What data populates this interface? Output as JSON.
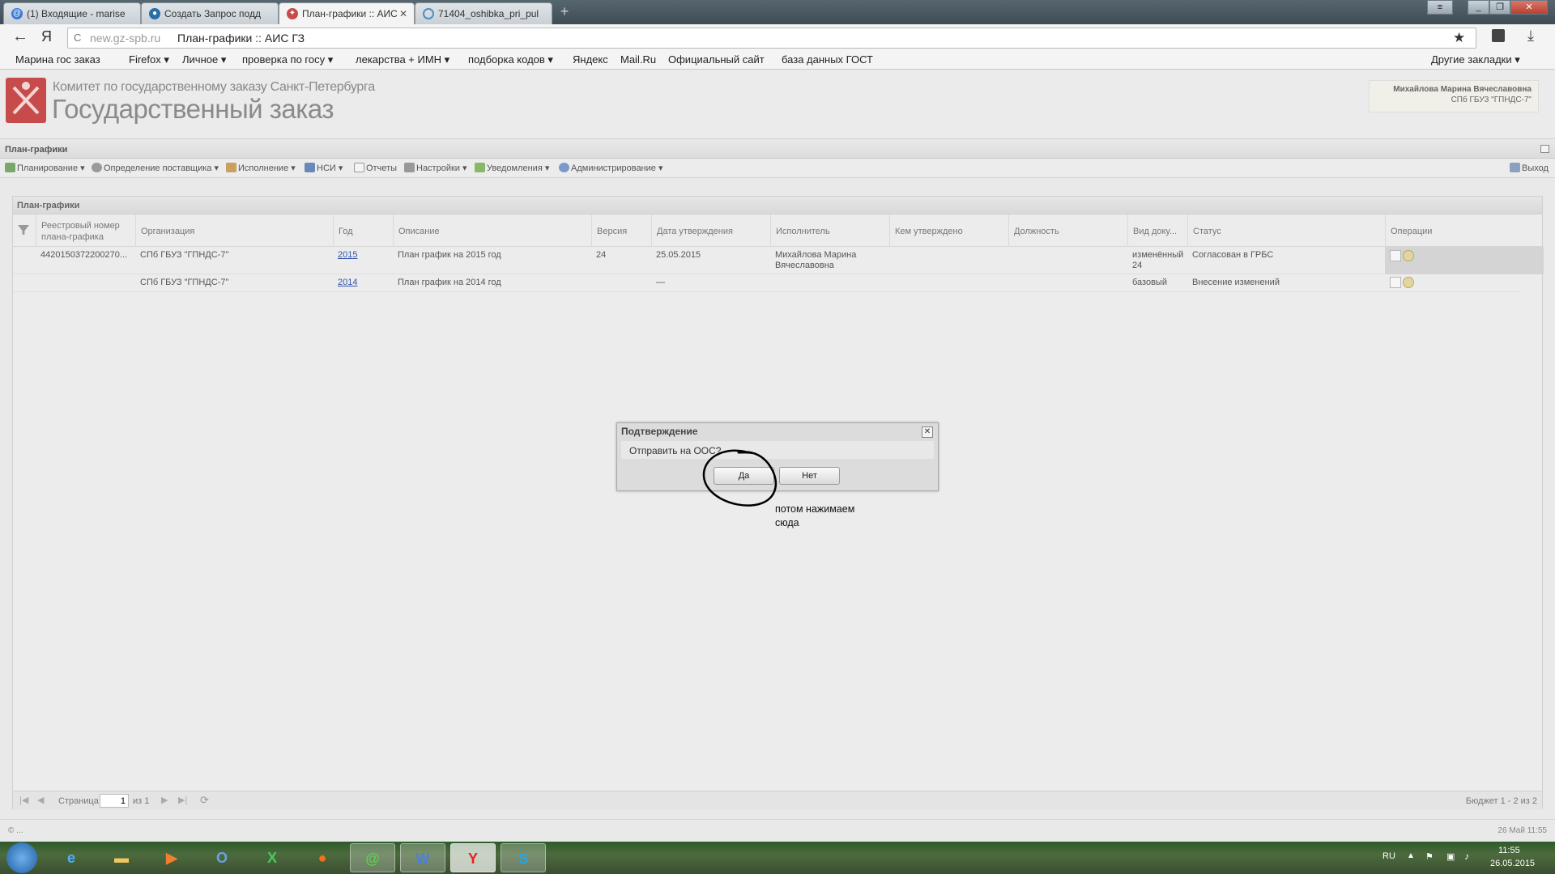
{
  "browser": {
    "tabs": [
      {
        "label": "(1) Входящие - marise"
      },
      {
        "label": "Создать Запрос подд"
      },
      {
        "label": "План-графики :: АИС"
      },
      {
        "label": "71404_oshibka_pri_pul"
      }
    ],
    "new_tab": "+",
    "window_controls": {
      "minimize": "_",
      "restore": "❐",
      "close": "✕"
    },
    "back_icon": "←",
    "yandex_icon": "Я",
    "reload_icon": "C",
    "address_domain": "new.gz-spb.ru",
    "address_title": "План-графики :: АИС ГЗ",
    "star_icon": "★",
    "bookmarks": [
      "Марина гос заказ",
      "Firefox ▾",
      "Личное ▾",
      "проверка по госу ▾",
      "лекарства + ИМН ▾",
      "подборка кодов ▾",
      "Яндекс",
      "Mail.Ru",
      "Официальный сайт",
      "база данных ГОСТ"
    ],
    "other_bookmarks": "Другие закладки ▾"
  },
  "header": {
    "subtitle": "Комитет по государственному заказу Санкт-Петербурга",
    "title": "Государственный заказ",
    "user_name": "Михайлова Марина Вячеславовна",
    "user_org": "СПб ГБУЗ \"ГПНДС-7\""
  },
  "section_title": "План-графики",
  "menu": [
    "Планирование ▾",
    "Определение поставщика ▾",
    "Исполнение ▾",
    "НСИ ▾",
    "Отчеты",
    "Настройки ▾",
    "Уведомления ▾",
    "Администрирование ▾"
  ],
  "exit_label": "Выход",
  "grid": {
    "title": "План-графики",
    "columns": [
      "Реестровый номер плана-графика",
      "Организация",
      "Год",
      "Описание",
      "Версия",
      "Дата утверждения",
      "Исполнитель",
      "Кем утверждено",
      "Должность",
      "Вид доку...",
      "Статус",
      "Операции"
    ],
    "rows": [
      {
        "reg_no": "4420150372200270...",
        "org": "СПб ГБУЗ \"ГПНДС-7\"",
        "year": "2015",
        "desc": "План график на 2015 год",
        "version": "24",
        "date": "25.05.2015",
        "executor": "Михайлова Марина Вячеславовна",
        "approved_by": "",
        "position": "",
        "doc_type": "изменённый 24",
        "status": "Согласован в ГРБС"
      },
      {
        "reg_no": "",
        "org": "СПб ГБУЗ \"ГПНДС-7\"",
        "year": "2014",
        "desc": "План график на 2014 год",
        "version": "",
        "date": "—",
        "executor": "",
        "approved_by": "",
        "position": "",
        "doc_type": "базовый",
        "status": "Внесение изменений"
      }
    ]
  },
  "pager": {
    "page_label": "Страница",
    "page_value": "1",
    "of_label": "из 1",
    "summary": "Бюджет 1 - 2 из 2"
  },
  "status_bar": {
    "left": "© ...",
    "right": "26 Май 11:55"
  },
  "dialog": {
    "title": "Подтверждение",
    "message": "Отправить на ООС?",
    "yes": "Да",
    "no": "Нет",
    "close": "✕"
  },
  "annotation": {
    "line1": "потом нажимаем",
    "line2": "сюда"
  },
  "taskbar": {
    "lang": "RU",
    "time": "11:55",
    "date": "26.05.2015"
  },
  "colors": {
    "crest": "#c84b4b",
    "link": "#3355aa"
  }
}
